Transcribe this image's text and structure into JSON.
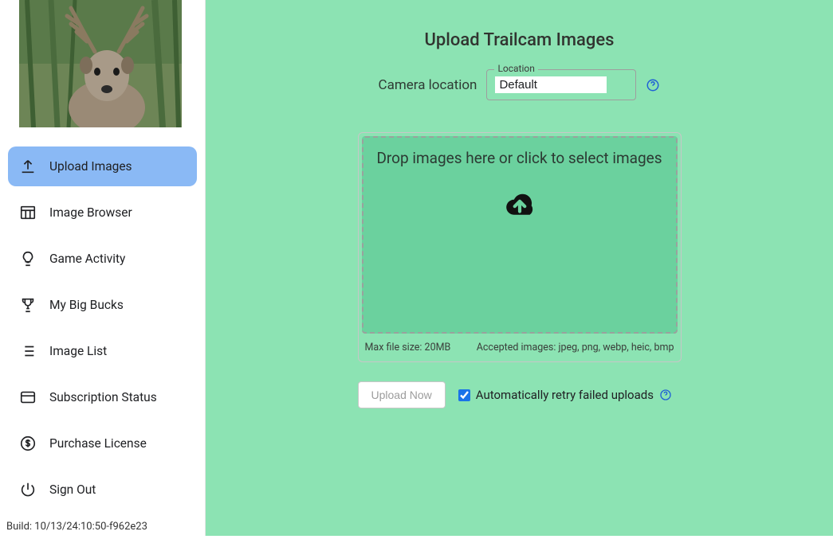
{
  "sidebar": {
    "items": [
      {
        "label": "Upload Images"
      },
      {
        "label": "Image Browser"
      },
      {
        "label": "Game Activity"
      },
      {
        "label": "My Big Bucks"
      },
      {
        "label": "Image List"
      },
      {
        "label": "Subscription Status"
      },
      {
        "label": "Purchase License"
      }
    ],
    "signout_label": "Sign Out",
    "build": "Build: 10/13/24:10:50-f962e23"
  },
  "page": {
    "title": "Upload Trailcam Images",
    "camera_location_label": "Camera location",
    "location_legend": "Location",
    "location_value": "Default",
    "dropzone_text": "Drop images here or click to select images",
    "max_file_size": "Max file size: 20MB",
    "accepted_formats": "Accepted images: jpeg, png, webp, heic, bmp",
    "upload_button": "Upload Now",
    "retry_label": "Automatically retry failed uploads",
    "retry_checked": true
  }
}
